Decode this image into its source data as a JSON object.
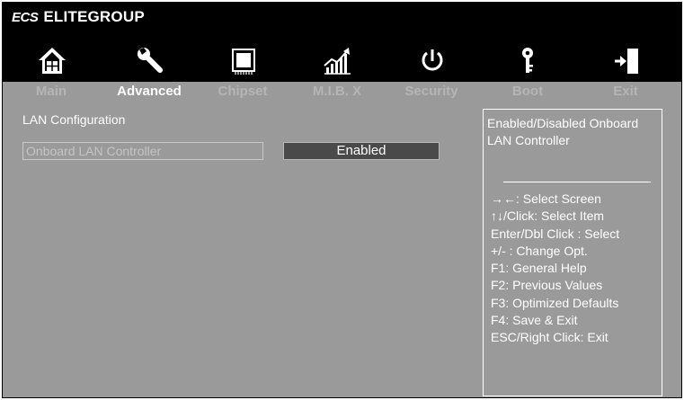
{
  "header": {
    "logo_text": "ECS",
    "brand_name": "ELITEGROUP"
  },
  "nav": {
    "tabs": [
      {
        "label": "Main",
        "icon": "home-icon"
      },
      {
        "label": "Advanced",
        "icon": "wrench-icon"
      },
      {
        "label": "Chipset",
        "icon": "chip-icon"
      },
      {
        "label": "M.I.B. X",
        "icon": "performance-chart-icon"
      },
      {
        "label": "Security",
        "icon": "power-icon"
      },
      {
        "label": "Boot",
        "icon": "key-icon"
      },
      {
        "label": "Exit",
        "icon": "exit-door-icon"
      }
    ],
    "active_tab": "Advanced"
  },
  "main": {
    "section_title": "LAN Configuration",
    "settings": [
      {
        "label": "Onboard LAN  Controller",
        "value": "Enabled"
      }
    ]
  },
  "help": {
    "description": "Enabled/Disabled Onboard LAN Controller",
    "keys": [
      "→←:  Select Screen",
      "↑↓/Click: Select Item",
      "Enter/Dbl Click : Select",
      "+/- : Change Opt.",
      "F1: General Help",
      "F2: Previous Values",
      "F3: Optimized Defaults",
      "F4: Save & Exit",
      "ESC/Right Click: Exit"
    ]
  },
  "colors": {
    "background": "#9a9a9a",
    "header": "#000000",
    "active_tab": "#ffffff",
    "inactive_tab": "#b5b5b5",
    "value_box": "#4a4a4a"
  }
}
